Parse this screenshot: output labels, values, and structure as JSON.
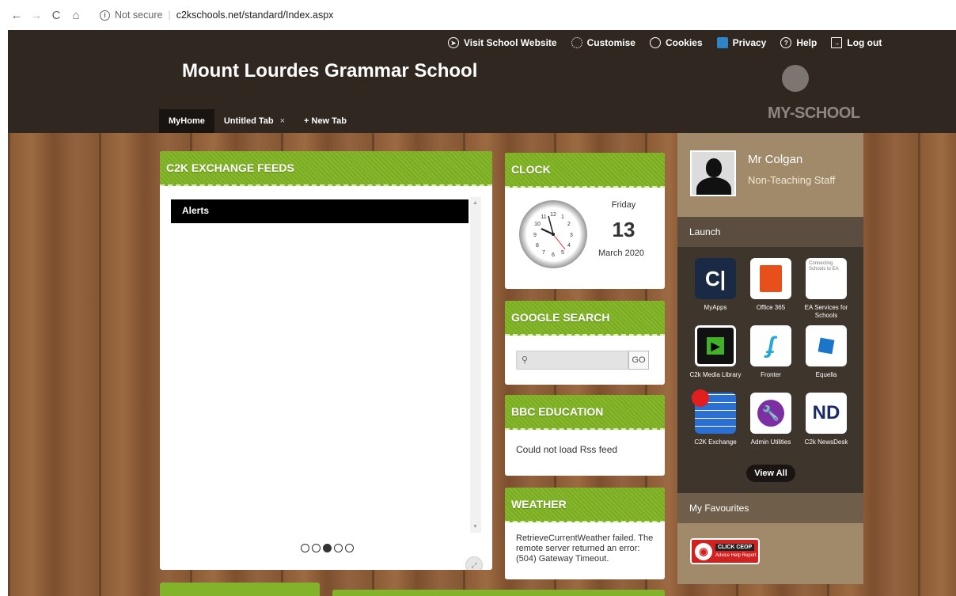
{
  "browser": {
    "back": "←",
    "forward": "→",
    "reload": "C",
    "home": "⌂",
    "security": "Not secure",
    "url": "c2kschools.net/standard/Index.aspx"
  },
  "header": {
    "school_name": "Mount Lourdes Grammar School",
    "links": [
      {
        "label": "Visit School Website",
        "icon": "cursor-circle-icon"
      },
      {
        "label": "Customise",
        "icon": "gear-icon"
      },
      {
        "label": "Cookies",
        "icon": "cookie-icon"
      },
      {
        "label": "Privacy",
        "icon": "privacy-people-icon"
      },
      {
        "label": "Help",
        "icon": "help-circle-icon"
      },
      {
        "label": "Log out",
        "icon": "logout-icon"
      }
    ],
    "logo_text": "MY-SCHOOL"
  },
  "tabs": [
    {
      "label": "MyHome",
      "active": true
    },
    {
      "label": "Untitled Tab",
      "close": "×"
    },
    {
      "label": "+ New Tab"
    }
  ],
  "widgets": {
    "feeds": {
      "title": "C2K EXCHANGE FEEDS",
      "alerts": "Alerts"
    },
    "clock": {
      "title": "CLOCK",
      "day": "Friday",
      "date": "13",
      "month": "March 2020"
    },
    "google": {
      "title": "GOOGLE SEARCH",
      "go": "GO"
    },
    "bbc": {
      "title": "BBC EDUCATION",
      "message": "Could not load Rss feed"
    },
    "weather": {
      "title": "WEATHER",
      "message": "RetrieveCurrentWeather failed. The remote server returned an error: (504) Gateway Timeout."
    }
  },
  "sidebar": {
    "user_name": "Mr Colgan",
    "user_role": "Non-Teaching Staff",
    "launch_title": "Launch",
    "apps": [
      {
        "label": "MyApps",
        "icon": "myapps-icon",
        "color": "#1b2a44"
      },
      {
        "label": "Office 365",
        "icon": "office-icon",
        "color": "#ffffff"
      },
      {
        "label": "EA Services for Schools",
        "icon": "ea-services-icon",
        "color": "#ffffff",
        "tile_text": "Connecting Schools to EA"
      },
      {
        "label": "C2k Media Library",
        "icon": "media-library-icon",
        "color": "#000000"
      },
      {
        "label": "Fronter",
        "icon": "fronter-icon",
        "color": "#ffffff"
      },
      {
        "label": "Equella",
        "icon": "equella-icon",
        "color": "#ffffff"
      },
      {
        "label": "C2K Exchange",
        "icon": "c2k-exchange-icon",
        "color": "#2a6fd1"
      },
      {
        "label": "Admin Utilities",
        "icon": "admin-utilities-icon",
        "color": "#ffffff"
      },
      {
        "label": "C2k NewsDesk",
        "icon": "newsdesk-icon",
        "color": "#ffffff",
        "tile_text": "ND"
      }
    ],
    "view_all": "View All",
    "favourites_title": "My Favourites",
    "ceop": {
      "t1": "CLICK CEOP",
      "t2": "Advice Help Report"
    }
  },
  "colors": {
    "header": "#2f2720",
    "widget_green": "#82b32a",
    "sidebar": "#3e352c",
    "profile": "#a08a6a"
  }
}
